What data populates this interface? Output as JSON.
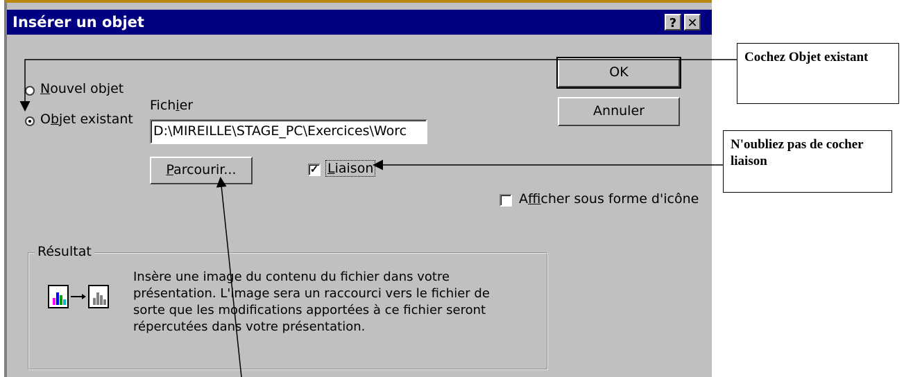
{
  "dialog": {
    "title": "Insérer un objet",
    "help_button": "?",
    "close_button": "✕",
    "radio_new": {
      "pre": "",
      "accel": "N",
      "post": "ouvel objet",
      "selected": false
    },
    "radio_existing": {
      "pre": "O",
      "accel": "b",
      "post": "jet existant",
      "selected": true
    },
    "file_label": {
      "pre": "Fich",
      "accel": "i",
      "post": "er"
    },
    "file_value": "D:\\MIREILLE\\STAGE_PC\\Exercices\\Worc",
    "browse_button": {
      "pre": "",
      "accel": "P",
      "post": "arcourir..."
    },
    "link_checkbox": {
      "accel": "L",
      "post": "iaison",
      "checked": true
    },
    "icon_checkbox": {
      "pre": "A",
      "accel": "f",
      "post": "ficher sous forme d'icône",
      "checked": false
    },
    "ok_button": "OK",
    "cancel_button": "Annuler",
    "result": {
      "title": "Résultat",
      "description": "Insère une image du contenu du fichier dans votre présentation. L'image sera un raccourci vers le fichier de sorte que les modifications apportées à ce fichier seront répercutées dans votre présentation."
    }
  },
  "callouts": {
    "check_existing": "Cochez Objet existant",
    "check_link": "N'oubliez pas de cocher liaison"
  },
  "colors": {
    "titlebar": "#000080",
    "dialog_bg": "#c0c0c0"
  }
}
